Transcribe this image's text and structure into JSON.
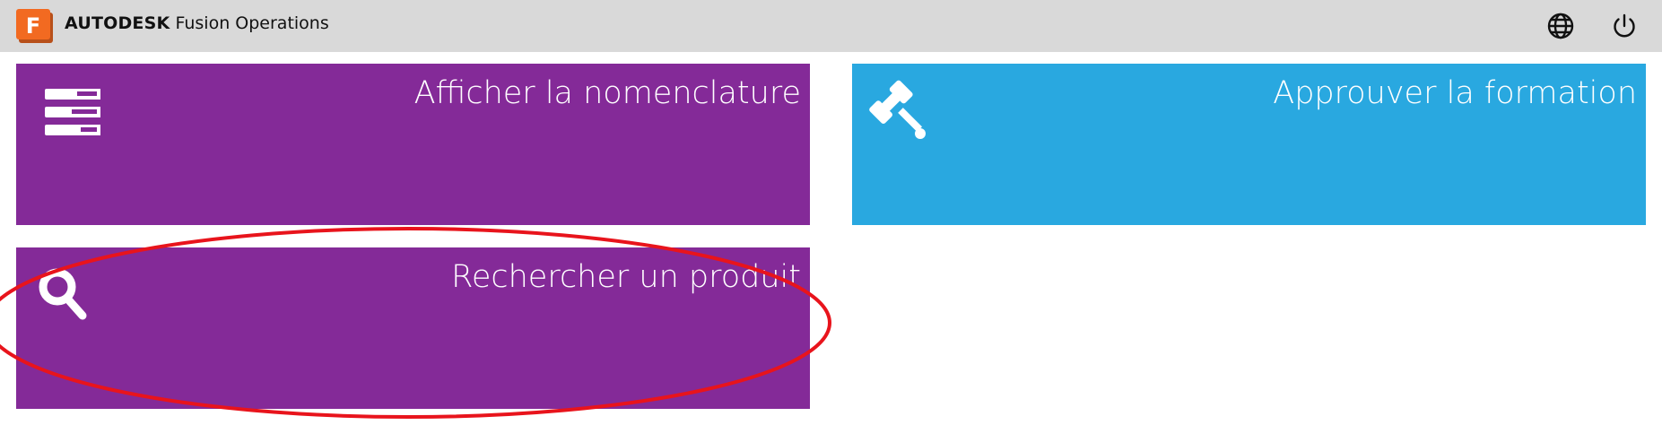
{
  "header": {
    "company": "AUTODESK",
    "product": "Fusion Operations",
    "logo_letter": "F",
    "icons": [
      "globe-icon",
      "power-icon"
    ]
  },
  "tiles": [
    {
      "label": "Afficher la nomenclature",
      "icon": "list-icon",
      "color": "#842a98"
    },
    {
      "label": "Approuver la formation",
      "icon": "gavel-icon",
      "color": "#29a8e0"
    },
    {
      "label": "Rechercher un produit",
      "icon": "search-icon",
      "color": "#842a98"
    }
  ],
  "colors": {
    "header_bg": "#d9d9d9",
    "logo": "#f26a21",
    "annotation": "#e8141c"
  }
}
